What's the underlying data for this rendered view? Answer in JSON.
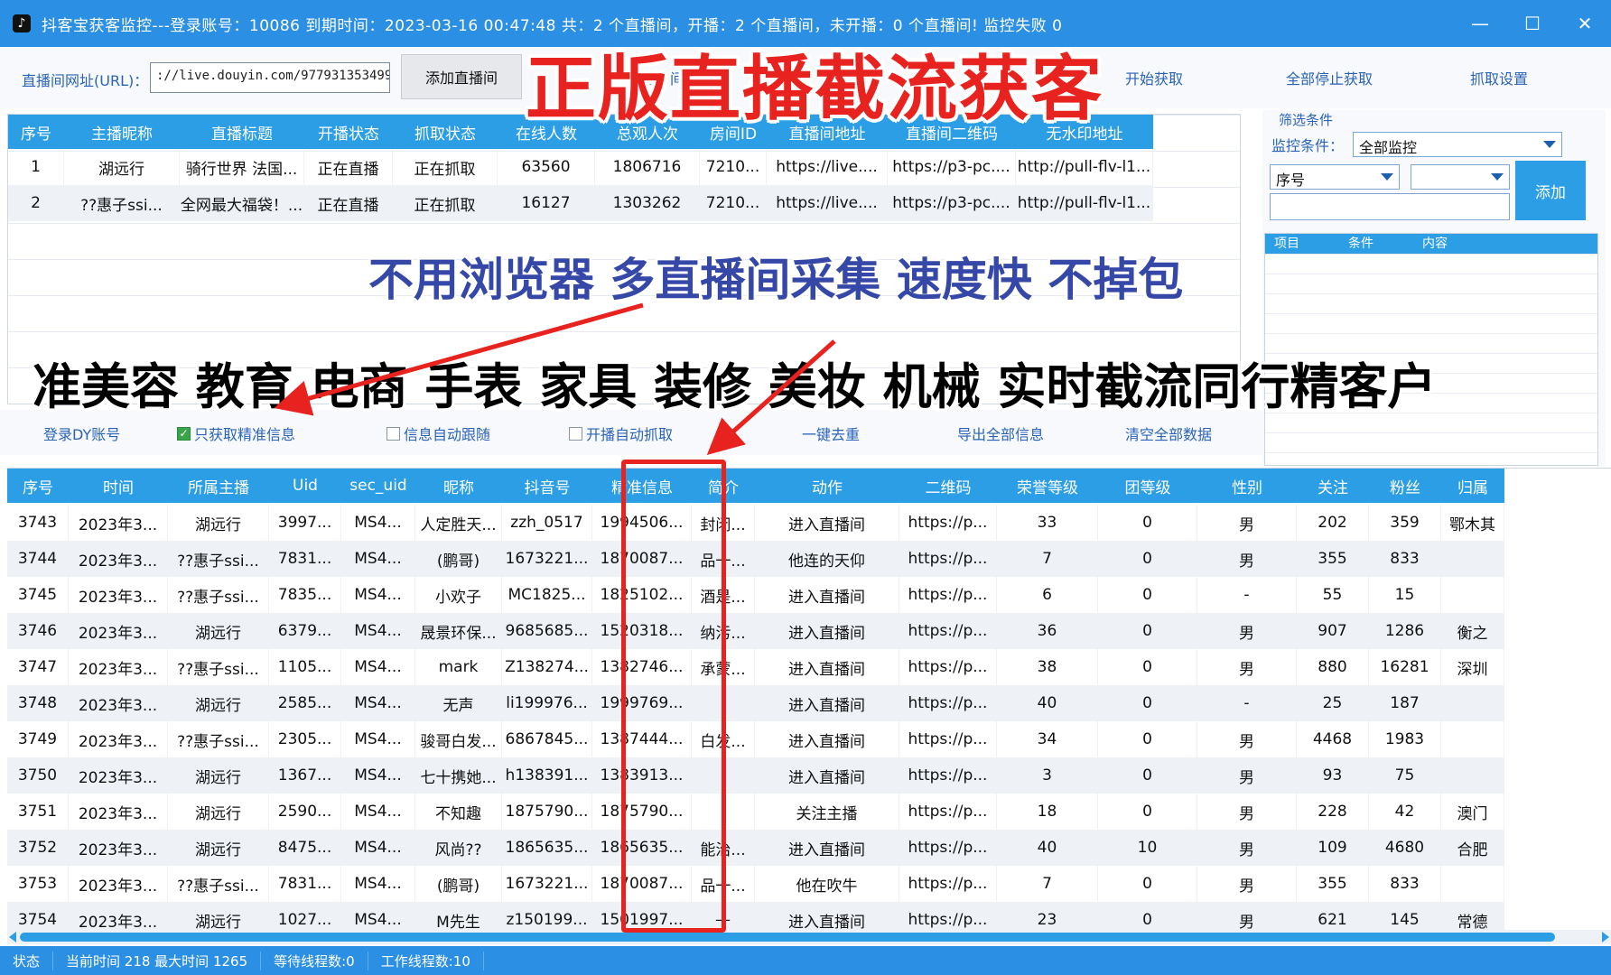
{
  "window": {
    "title": "抖客宝获客监控---登录账号：10086   到期时间：2023-03-16 00:47:48   共：2 个直播间，开播：2 个直播间，未开播：0 个直播间!   监控失败 0",
    "icon": "douyin-logo-icon"
  },
  "toolbar": {
    "url_label": "直播间网址(URL)：",
    "url_value": "://live.douyin.com/977931353499",
    "add_room_label": "添加直播间",
    "links": [
      "一人",
      "间",
      "列",
      "",
      "开始获取",
      "全部停止获取",
      "抓取设置"
    ]
  },
  "top_table": {
    "columns": [
      "序号",
      "主播昵称",
      "直播标题",
      "开播状态",
      "抓取状态",
      "在线人数",
      "总观人次",
      "房间ID",
      "直播间地址",
      "直播间二维码",
      "无水印地址"
    ],
    "rows": [
      [
        "1",
        "湖远行",
        "骑行世界 法国...",
        "正在直播",
        "正在抓取",
        "63560",
        "1806716",
        "7210...",
        "https://live....",
        "https://p3-pc....",
        "http://pull-flv-l1..."
      ],
      [
        "2",
        "??惠子ssi...",
        "全网最大福袋！...",
        "正在直播",
        "正在抓取",
        "16127",
        "1303262",
        "7210...",
        "https://live....",
        "https://p3-pc....",
        "http://pull-flv-l1..."
      ]
    ]
  },
  "filter": {
    "group_title": "筛选条件",
    "cond_label": "监控条件：",
    "cond_value": "全部监控",
    "field_value": "序号",
    "op_value": "",
    "add_label": "添加",
    "list_headers": [
      "项目",
      "条件",
      "内容"
    ]
  },
  "options": {
    "login_label": "登录DY账号",
    "only_precise_label": "只获取精准信息",
    "only_precise_checked": true,
    "auto_follow_label": "信息自动跟随",
    "auto_follow_checked": false,
    "auto_grab_label": "开播自动抓取",
    "auto_grab_checked": false,
    "dedupe_label": "一键去重",
    "export_label": "导出全部信息",
    "clear_label": "清空全部数据"
  },
  "bottom_table": {
    "columns": [
      "序号",
      "时间",
      "所属主播",
      "Uid",
      "sec_uid",
      "昵称",
      "抖音号",
      "精准信息",
      "简介",
      "动作",
      "二维码",
      "荣誉等级",
      "团等级",
      "性别",
      "关注",
      "粉丝",
      "归属"
    ],
    "rows": [
      [
        "3743",
        "2023年3...",
        "湖远行",
        "3997...",
        "MS4...",
        "人定胜天...",
        "zzh_0517",
        "1994506...",
        "封闭...",
        "进入直播间",
        "https://p...",
        "33",
        "0",
        "男",
        "202",
        "359",
        "鄂木其"
      ],
      [
        "3744",
        "2023年3...",
        "??惠子ssi...",
        "7831...",
        "MS4...",
        "(鹏哥)",
        "1673221...",
        "1870087...",
        "品一...",
        "他连的天仰",
        "https://p...",
        "7",
        "0",
        "男",
        "355",
        "833",
        ""
      ],
      [
        "3745",
        "2023年3...",
        "??惠子ssi...",
        "7835...",
        "MS4...",
        "小欢子",
        "MC1825...",
        "1825102...",
        "酒是...",
        "进入直播间",
        "https://p...",
        "6",
        "0",
        "-",
        "55",
        "15",
        ""
      ],
      [
        "3746",
        "2023年3...",
        "湖远行",
        "6379...",
        "MS4...",
        "晟景环保...",
        "9685685...",
        "1520318...",
        "纳污...",
        "进入直播间",
        "https://p...",
        "36",
        "0",
        "男",
        "907",
        "1286",
        "衡之"
      ],
      [
        "3747",
        "2023年3...",
        "??惠子ssi...",
        "1105...",
        "MS4...",
        "mark",
        "Z138274...",
        "1382746...",
        "承蒙...",
        "进入直播间",
        "https://p...",
        "38",
        "0",
        "男",
        "880",
        "16281",
        "深圳"
      ],
      [
        "3748",
        "2023年3...",
        "湖远行",
        "2585...",
        "MS4...",
        "无声",
        "li199976...",
        "1999769...",
        "",
        "进入直播间",
        "https://p...",
        "40",
        "0",
        "-",
        "25",
        "187",
        ""
      ],
      [
        "3749",
        "2023年3...",
        "??惠子ssi...",
        "2305...",
        "MS4...",
        "骏哥白发...",
        "6867845...",
        "1387444...",
        "白发...",
        "进入直播间",
        "https://p...",
        "34",
        "0",
        "男",
        "4468",
        "1983",
        ""
      ],
      [
        "3750",
        "2023年3...",
        "湖远行",
        "1367...",
        "MS4...",
        "七十携她...",
        "h138391...",
        "1383913...",
        "",
        "进入直播间",
        "https://p...",
        "3",
        "0",
        "男",
        "93",
        "75",
        ""
      ],
      [
        "3751",
        "2023年3...",
        "湖远行",
        "2590...",
        "MS4...",
        "不知趣",
        "1875790...",
        "1875790...",
        "",
        "关注主播",
        "https://p...",
        "18",
        "0",
        "男",
        "228",
        "42",
        "澳门"
      ],
      [
        "3752",
        "2023年3...",
        "湖远行",
        "8475...",
        "MS4...",
        "风尚??",
        "1865635...",
        "1865635...",
        "能治...",
        "进入直播间",
        "https://p...",
        "40",
        "10",
        "男",
        "109",
        "4680",
        "合肥"
      ],
      [
        "3753",
        "2023年3...",
        "??惠子ssi...",
        "7831...",
        "MS4...",
        "(鹏哥)",
        "1673221...",
        "1870087...",
        "品一...",
        "他在吹牛",
        "https://p...",
        "7",
        "0",
        "男",
        "355",
        "833",
        ""
      ],
      [
        "3754",
        "2023年3...",
        "湖远行",
        "1027...",
        "MS4...",
        "M先生",
        "z150199...",
        "1501997...",
        "—",
        "进入直播间",
        "https://p...",
        "23",
        "0",
        "男",
        "621",
        "145",
        "常德"
      ]
    ]
  },
  "status": {
    "state_label": "状态",
    "time_text": "当前时间 218  最大时间 1265",
    "waiting_text": "等待线程数:0",
    "working_text": "工作线程数:10"
  },
  "overlay": {
    "headline": "正版直播截流获客",
    "subline": "不用浏览器 多直播间采集 速度快 不掉包",
    "industries": "准美容 教育 电商 手表 家具 装修 美妆 机械 实时截流同行精客户"
  },
  "colors": {
    "accent": "#2b9ee6",
    "titlebar": "#2b8fe3",
    "highlight_red": "#e8231f",
    "subline_blue": "#3548a8"
  }
}
